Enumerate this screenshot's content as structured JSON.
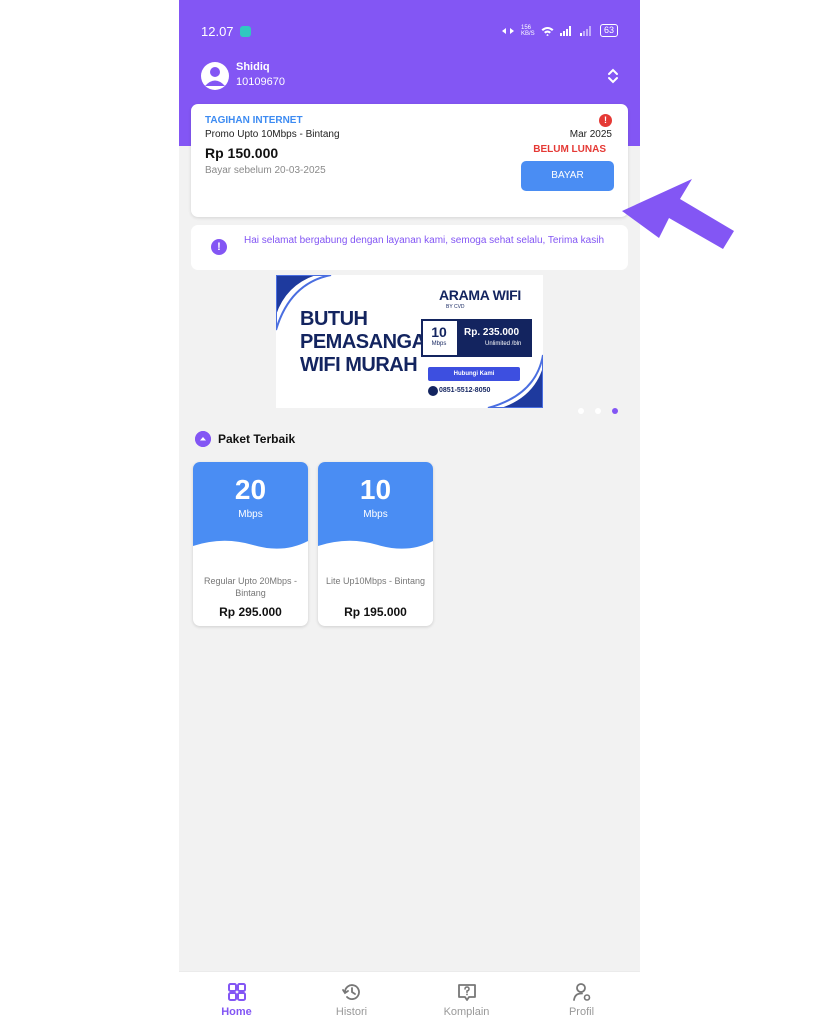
{
  "status_bar": {
    "time": "12.07",
    "network_speed": "156 KB/S",
    "battery": "63"
  },
  "user": {
    "name": "Shidiq",
    "id": "10109670"
  },
  "bill": {
    "title": "TAGIHAN INTERNET",
    "plan": "Promo Upto 10Mbps - Bintang",
    "amount": "Rp 150.000",
    "due": "Bayar sebelum 20-03-2025",
    "period": "Mar 2025",
    "status": "BELUM LUNAS",
    "pay_label": "BAYAR",
    "alert": "!"
  },
  "notice": {
    "icon": "!",
    "text": "Hai selamat bergabung dengan layanan kami, semoga sehat selalu, Terima kasih"
  },
  "banner": {
    "headline_1": "BUTUH",
    "headline_2": "PEMASANGAN",
    "headline_3": "WIFI MURAH",
    "brand": "ARAMA WIFI",
    "brand_sub": "BY CVD",
    "speed": "10",
    "speed_unit": "Mbps",
    "price": "Rp. 235.000",
    "price_sub": "Unlimited /bln",
    "contact_label": "Hubungi Kami",
    "phone": "0851-5512-8050",
    "slide_count": 3,
    "active_slide": 3
  },
  "packages": {
    "title": "Paket Terbaik",
    "items": [
      {
        "speed": "20",
        "unit": "Mbps",
        "name": "Regular Upto 20Mbps - Bintang",
        "price": "Rp 295.000"
      },
      {
        "speed": "10",
        "unit": "Mbps",
        "name": "Lite Up10Mbps - Bintang",
        "price": "Rp 195.000"
      }
    ]
  },
  "nav": {
    "items": [
      {
        "label": "Home",
        "icon": "grid-icon",
        "active": true
      },
      {
        "label": "Histori",
        "icon": "history-icon",
        "active": false
      },
      {
        "label": "Komplain",
        "icon": "complaint-icon",
        "active": false
      },
      {
        "label": "Profil",
        "icon": "profile-icon",
        "active": false
      }
    ]
  },
  "colors": {
    "primary": "#8356f4",
    "accent_blue": "#4a8df3",
    "danger": "#e53935",
    "background": "#f2f2f2"
  }
}
